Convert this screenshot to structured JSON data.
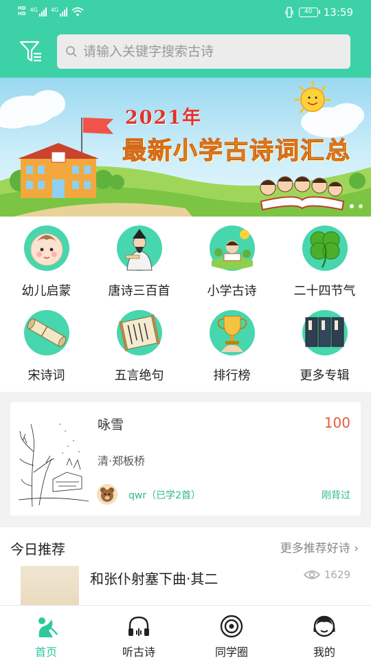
{
  "status_bar": {
    "network_left": "4G",
    "network_right": "4G",
    "battery": "40",
    "time": "13:59"
  },
  "search": {
    "placeholder": "请输入关键字搜索古诗"
  },
  "banner": {
    "year": "2021年",
    "title": "最新小学古诗词汇总"
  },
  "categories": [
    {
      "label": "幼儿启蒙",
      "icon": "baby-icon"
    },
    {
      "label": "唐诗三百首",
      "icon": "poet-icon"
    },
    {
      "label": "小学古诗",
      "icon": "child-reading-icon"
    },
    {
      "label": "二十四节气",
      "icon": "clover-icon"
    },
    {
      "label": "宋诗词",
      "icon": "scroll-icon"
    },
    {
      "label": "五言绝句",
      "icon": "calligraphy-scroll-icon"
    },
    {
      "label": "排行榜",
      "icon": "trophy-icon"
    },
    {
      "label": "更多专辑",
      "icon": "books-icon"
    }
  ],
  "featured": {
    "title": "咏雪",
    "score": "100",
    "author": "清·郑板桥",
    "user": "qwr（已学2首）",
    "status": "刚背过"
  },
  "recommend": {
    "title": "今日推荐",
    "more": "更多推荐好诗",
    "poem": "和张仆射塞下曲·其二",
    "views": "1629"
  },
  "nav": [
    {
      "label": "首页",
      "icon": "home-icon",
      "active": true
    },
    {
      "label": "听古诗",
      "icon": "headphones-icon",
      "active": false
    },
    {
      "label": "同学圈",
      "icon": "circle-icon",
      "active": false
    },
    {
      "label": "我的",
      "icon": "profile-icon",
      "active": false
    }
  ],
  "colors": {
    "accent": "#3dd1a8",
    "score": "#e45c3a",
    "link": "#2ab893"
  }
}
